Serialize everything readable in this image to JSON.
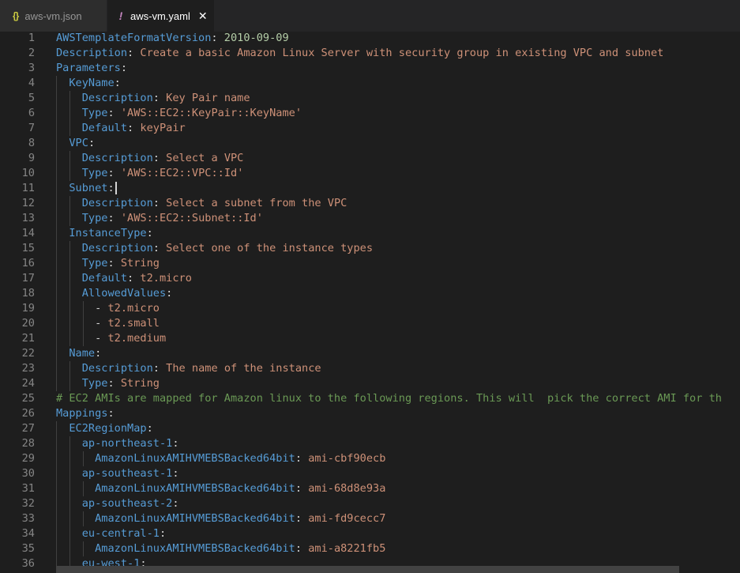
{
  "tabs": [
    {
      "icon": "json-file-icon",
      "icon_glyph": "{}",
      "label": "aws-vm.json"
    },
    {
      "icon": "yaml-file-icon",
      "icon_glyph": "!",
      "label": "aws-vm.yaml",
      "close": "✕"
    }
  ],
  "lines": [
    {
      "n": "1",
      "indent": "",
      "segs": [
        [
          "k",
          "AWSTemplateFormatVersion"
        ],
        [
          "p",
          ": "
        ],
        [
          "n",
          "2010-09-09"
        ]
      ]
    },
    {
      "n": "2",
      "indent": "",
      "segs": [
        [
          "k",
          "Description"
        ],
        [
          "p",
          ": "
        ],
        [
          "v",
          "Create a basic Amazon Linux Server with security group in existing VPC and subnet"
        ]
      ]
    },
    {
      "n": "3",
      "indent": "",
      "segs": [
        [
          "k",
          "Parameters"
        ],
        [
          "p",
          ":"
        ]
      ]
    },
    {
      "n": "4",
      "indent": "  ",
      "segs": [
        [
          "k",
          "KeyName"
        ],
        [
          "p",
          ":"
        ]
      ]
    },
    {
      "n": "5",
      "indent": "    ",
      "segs": [
        [
          "k",
          "Description"
        ],
        [
          "p",
          ": "
        ],
        [
          "v",
          "Key Pair name"
        ]
      ]
    },
    {
      "n": "6",
      "indent": "    ",
      "segs": [
        [
          "k",
          "Type"
        ],
        [
          "p",
          ": "
        ],
        [
          "v",
          "'AWS::EC2::KeyPair::KeyName'"
        ]
      ]
    },
    {
      "n": "7",
      "indent": "    ",
      "segs": [
        [
          "k",
          "Default"
        ],
        [
          "p",
          ": "
        ],
        [
          "v",
          "keyPair"
        ]
      ]
    },
    {
      "n": "8",
      "indent": "  ",
      "segs": [
        [
          "k",
          "VPC"
        ],
        [
          "p",
          ":"
        ]
      ]
    },
    {
      "n": "9",
      "indent": "    ",
      "segs": [
        [
          "k",
          "Description"
        ],
        [
          "p",
          ": "
        ],
        [
          "v",
          "Select a VPC"
        ]
      ]
    },
    {
      "n": "10",
      "indent": "    ",
      "segs": [
        [
          "k",
          "Type"
        ],
        [
          "p",
          ": "
        ],
        [
          "v",
          "'AWS::EC2::VPC::Id'"
        ]
      ]
    },
    {
      "n": "11",
      "indent": "  ",
      "segs": [
        [
          "k",
          "Subnet"
        ],
        [
          "p",
          ":"
        ]
      ],
      "cursor": true
    },
    {
      "n": "12",
      "indent": "    ",
      "segs": [
        [
          "k",
          "Description"
        ],
        [
          "p",
          ": "
        ],
        [
          "v",
          "Select a subnet from the VPC"
        ]
      ]
    },
    {
      "n": "13",
      "indent": "    ",
      "segs": [
        [
          "k",
          "Type"
        ],
        [
          "p",
          ": "
        ],
        [
          "v",
          "'AWS::EC2::Subnet::Id'"
        ]
      ]
    },
    {
      "n": "14",
      "indent": "  ",
      "segs": [
        [
          "k",
          "InstanceType"
        ],
        [
          "p",
          ":"
        ]
      ]
    },
    {
      "n": "15",
      "indent": "    ",
      "segs": [
        [
          "k",
          "Description"
        ],
        [
          "p",
          ": "
        ],
        [
          "v",
          "Select one of the instance types"
        ]
      ]
    },
    {
      "n": "16",
      "indent": "    ",
      "segs": [
        [
          "k",
          "Type"
        ],
        [
          "p",
          ": "
        ],
        [
          "v",
          "String"
        ]
      ]
    },
    {
      "n": "17",
      "indent": "    ",
      "segs": [
        [
          "k",
          "Default"
        ],
        [
          "p",
          ": "
        ],
        [
          "v",
          "t2.micro"
        ]
      ]
    },
    {
      "n": "18",
      "indent": "    ",
      "segs": [
        [
          "k",
          "AllowedValues"
        ],
        [
          "p",
          ":"
        ]
      ]
    },
    {
      "n": "19",
      "indent": "      ",
      "segs": [
        [
          "p",
          "- "
        ],
        [
          "v",
          "t2.micro"
        ]
      ]
    },
    {
      "n": "20",
      "indent": "      ",
      "segs": [
        [
          "p",
          "- "
        ],
        [
          "v",
          "t2.small"
        ]
      ]
    },
    {
      "n": "21",
      "indent": "      ",
      "segs": [
        [
          "p",
          "- "
        ],
        [
          "v",
          "t2.medium"
        ]
      ]
    },
    {
      "n": "22",
      "indent": "  ",
      "segs": [
        [
          "k",
          "Name"
        ],
        [
          "p",
          ":"
        ]
      ]
    },
    {
      "n": "23",
      "indent": "    ",
      "segs": [
        [
          "k",
          "Description"
        ],
        [
          "p",
          ": "
        ],
        [
          "v",
          "The name of the instance"
        ]
      ]
    },
    {
      "n": "24",
      "indent": "    ",
      "segs": [
        [
          "k",
          "Type"
        ],
        [
          "p",
          ": "
        ],
        [
          "v",
          "String"
        ]
      ]
    },
    {
      "n": "25",
      "indent": "",
      "segs": [
        [
          "c",
          "# EC2 AMIs are mapped for Amazon linux to the following regions. This will  pick the correct AMI for th"
        ]
      ]
    },
    {
      "n": "26",
      "indent": "",
      "segs": [
        [
          "k",
          "Mappings"
        ],
        [
          "p",
          ":"
        ]
      ]
    },
    {
      "n": "27",
      "indent": "  ",
      "segs": [
        [
          "k",
          "EC2RegionMap"
        ],
        [
          "p",
          ":"
        ]
      ]
    },
    {
      "n": "28",
      "indent": "    ",
      "segs": [
        [
          "k",
          "ap-northeast-1"
        ],
        [
          "p",
          ":"
        ]
      ]
    },
    {
      "n": "29",
      "indent": "      ",
      "segs": [
        [
          "k",
          "AmazonLinuxAMIHVMEBSBacked64bit"
        ],
        [
          "p",
          ": "
        ],
        [
          "v",
          "ami-cbf90ecb"
        ]
      ]
    },
    {
      "n": "30",
      "indent": "    ",
      "segs": [
        [
          "k",
          "ap-southeast-1"
        ],
        [
          "p",
          ":"
        ]
      ]
    },
    {
      "n": "31",
      "indent": "      ",
      "segs": [
        [
          "k",
          "AmazonLinuxAMIHVMEBSBacked64bit"
        ],
        [
          "p",
          ": "
        ],
        [
          "v",
          "ami-68d8e93a"
        ]
      ]
    },
    {
      "n": "32",
      "indent": "    ",
      "segs": [
        [
          "k",
          "ap-southeast-2"
        ],
        [
          "p",
          ":"
        ]
      ]
    },
    {
      "n": "33",
      "indent": "      ",
      "segs": [
        [
          "k",
          "AmazonLinuxAMIHVMEBSBacked64bit"
        ],
        [
          "p",
          ": "
        ],
        [
          "v",
          "ami-fd9cecc7"
        ]
      ]
    },
    {
      "n": "34",
      "indent": "    ",
      "segs": [
        [
          "k",
          "eu-central-1"
        ],
        [
          "p",
          ":"
        ]
      ]
    },
    {
      "n": "35",
      "indent": "      ",
      "segs": [
        [
          "k",
          "AmazonLinuxAMIHVMEBSBacked64bit"
        ],
        [
          "p",
          ": "
        ],
        [
          "v",
          "ami-a8221fb5"
        ]
      ]
    },
    {
      "n": "36",
      "indent": "    ",
      "segs": [
        [
          "k",
          "eu-west-1"
        ],
        [
          "p",
          ":"
        ]
      ]
    }
  ],
  "colors": {
    "key": "#569cd6",
    "string": "#ce9178",
    "number": "#b5cea8",
    "comment": "#6a9955",
    "background": "#1e1e1e"
  }
}
